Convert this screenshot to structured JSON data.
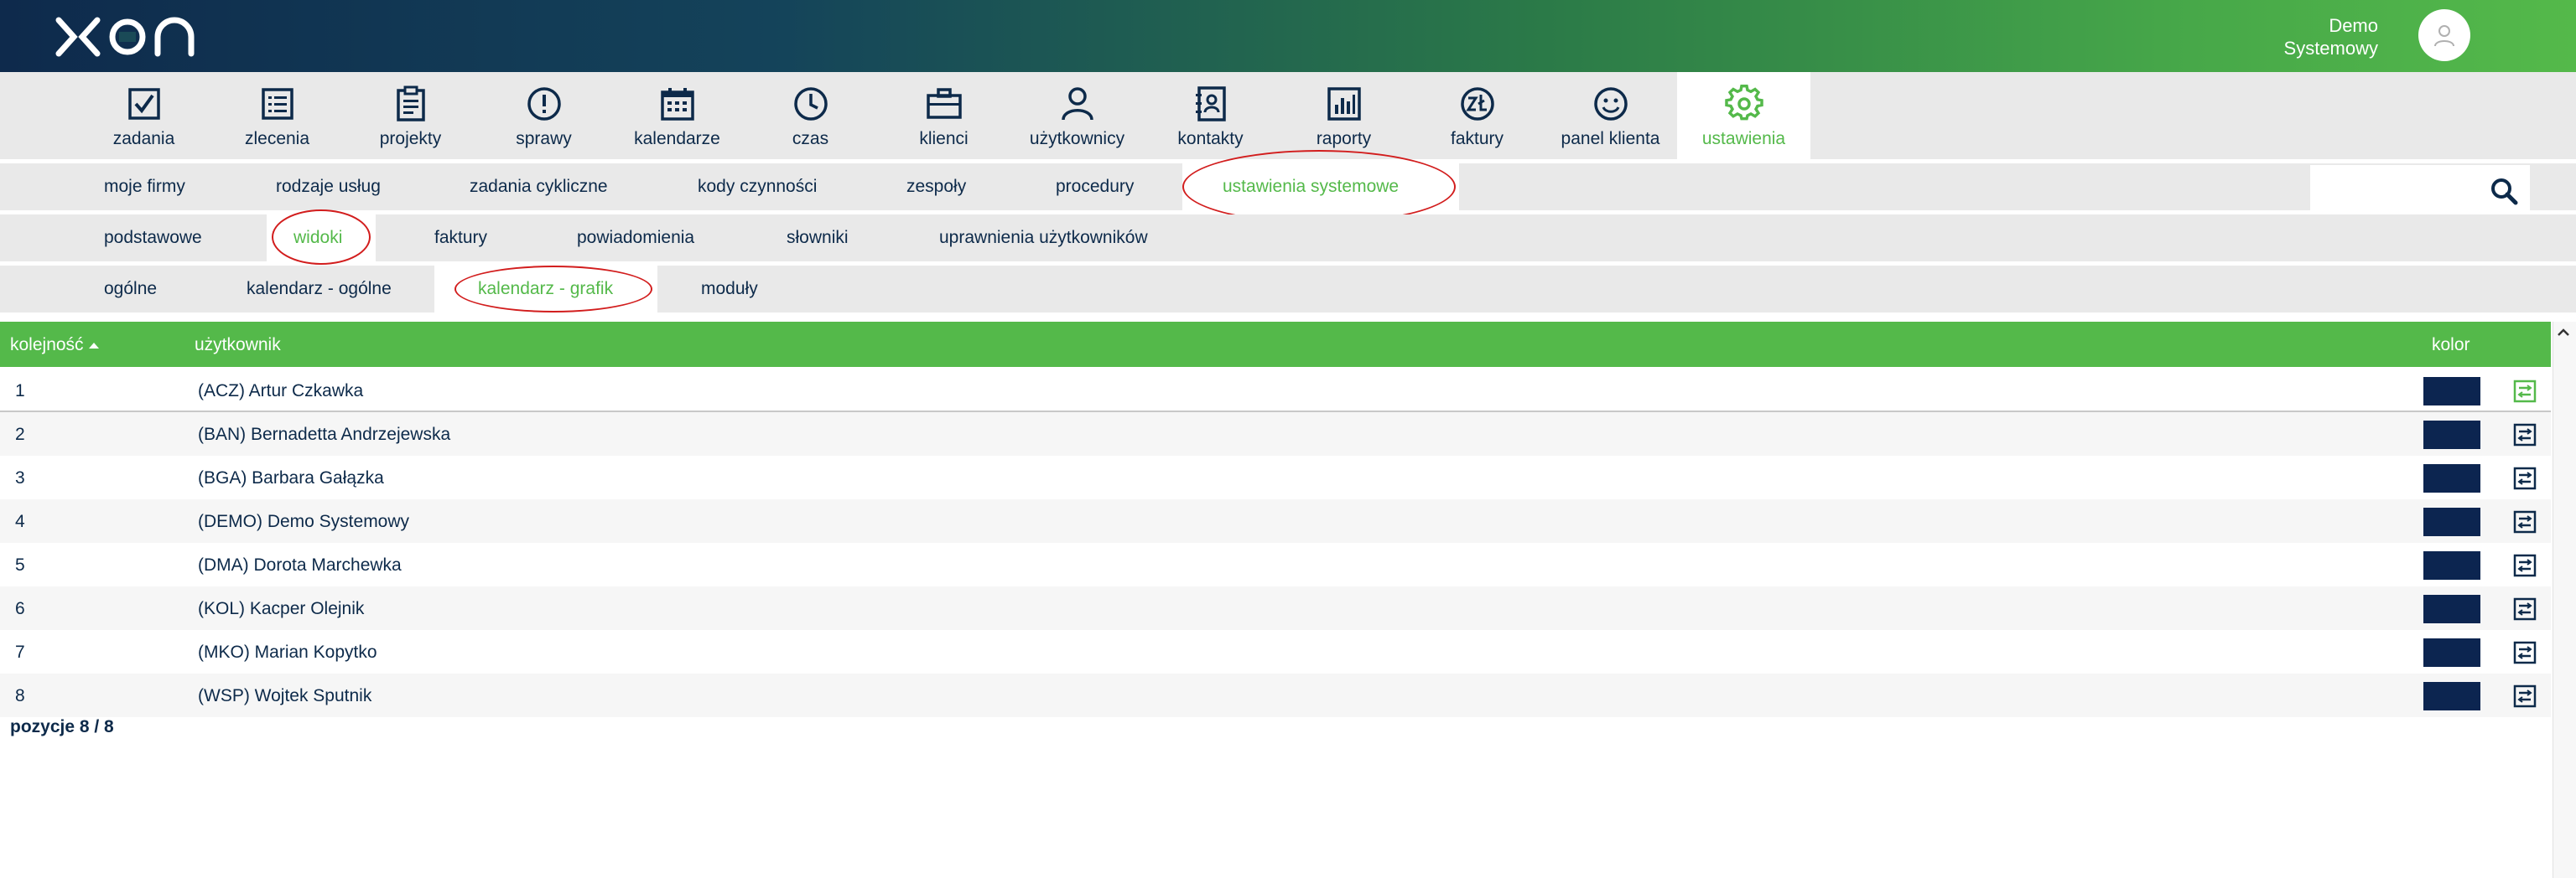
{
  "header": {
    "user_line1": "Demo",
    "user_line2": "Systemowy"
  },
  "main_nav": [
    {
      "label": "zadania",
      "icon": "checkbox-icon"
    },
    {
      "label": "zlecenia",
      "icon": "list-icon"
    },
    {
      "label": "projekty",
      "icon": "clipboard-icon"
    },
    {
      "label": "sprawy",
      "icon": "exclamation-icon"
    },
    {
      "label": "kalendarze",
      "icon": "calendar-icon"
    },
    {
      "label": "czas",
      "icon": "clock-icon"
    },
    {
      "label": "klienci",
      "icon": "briefcase-icon"
    },
    {
      "label": "użytkownicy",
      "icon": "user-icon"
    },
    {
      "label": "kontakty",
      "icon": "address-book-icon"
    },
    {
      "label": "raporty",
      "icon": "bar-chart-icon"
    },
    {
      "label": "faktury",
      "icon": "zloty-icon"
    },
    {
      "label": "panel klienta",
      "icon": "smiley-icon"
    },
    {
      "label": "ustawienia",
      "icon": "gear-icon",
      "active": true
    }
  ],
  "sub_nav_1": [
    "moje firmy",
    "rodzaje usług",
    "zadania cykliczne",
    "kody czynności",
    "zespoły",
    "procedury",
    "ustawienia systemowe"
  ],
  "sub_nav_2": [
    "podstawowe",
    "widoki",
    "faktury",
    "powiadomienia",
    "słowniki",
    "uprawnienia użytkowników"
  ],
  "sub_nav_3": [
    "ogólne",
    "kalendarz - ogólne",
    "kalendarz - grafik",
    "moduły"
  ],
  "table": {
    "headers": {
      "order": "kolejność",
      "user": "użytkownik",
      "color": "kolor"
    },
    "rows": [
      {
        "order": "1",
        "user": "(ACZ) Artur Czkawka",
        "color": "#0c2550"
      },
      {
        "order": "2",
        "user": "(BAN) Bernadetta Andrzejewska",
        "color": "#0c2550"
      },
      {
        "order": "3",
        "user": "(BGA) Barbara Gałązka",
        "color": "#0c2550"
      },
      {
        "order": "4",
        "user": "(DEMO) Demo Systemowy",
        "color": "#0c2550"
      },
      {
        "order": "5",
        "user": "(DMA) Dorota Marchewka",
        "color": "#0c2550"
      },
      {
        "order": "6",
        "user": "(KOL) Kacper Olejnik",
        "color": "#0c2550"
      },
      {
        "order": "7",
        "user": "(MKO) Marian Kopytko",
        "color": "#0c2550"
      },
      {
        "order": "8",
        "user": "(WSP) Wojtek Sputnik",
        "color": "#0c2550"
      }
    ]
  },
  "footer": {
    "positions": "pozycje 8 / 8"
  },
  "colors": {
    "accent": "#54b94a",
    "navy": "#0d2a4a",
    "highlight_ring": "#d21d1d"
  }
}
